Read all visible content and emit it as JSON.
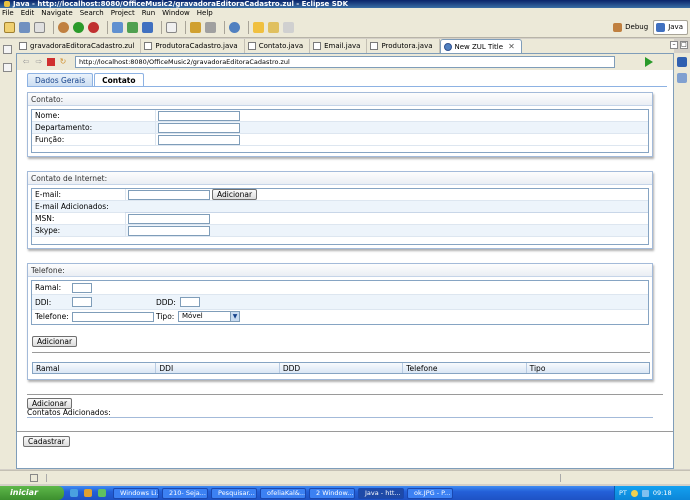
{
  "window": {
    "title": "Java - http://localhost:8080/OfficeMusic2/gravadoraEditoraCadastro.zul - Eclipse SDK"
  },
  "menu": [
    "File",
    "Edit",
    "Navigate",
    "Search",
    "Project",
    "Run",
    "Window",
    "Help"
  ],
  "perspectives": [
    {
      "label": "Debug",
      "active": false
    },
    {
      "label": "Java",
      "active": true
    }
  ],
  "editor_tabs": [
    {
      "label": "gravadoraEditoraCadastro.zul",
      "active": false
    },
    {
      "label": "ProdutoraCadastro.java",
      "active": false
    },
    {
      "label": "Contato.java",
      "active": false
    },
    {
      "label": "Email.java",
      "active": false
    },
    {
      "label": "Produtora.java",
      "active": false
    },
    {
      "label": "New ZUL Title",
      "active": true
    }
  ],
  "browser": {
    "url": "http://localhost:8080/OfficeMusic2/gravadoraEditoraCadastro.zul"
  },
  "page": {
    "tabs": [
      {
        "label": "Dados Gerais",
        "selected": false
      },
      {
        "label": "Contato",
        "selected": true
      }
    ],
    "contato": {
      "caption": "Contato:",
      "fields": [
        "Nome:",
        "Departamento:",
        "Função:"
      ]
    },
    "internet": {
      "caption": "Contato de Internet:",
      "email_label": "E-mail:",
      "add_label": "Adicionar",
      "added_label": "E-mail Adicionados:",
      "msn_label": "MSN:",
      "skype_label": "Skype:"
    },
    "telefone": {
      "caption": "Telefone:",
      "ramal_label": "Ramal:",
      "ddi_label": "DDI:",
      "ddd_label": "DDD:",
      "telefone_label": "Telefone:",
      "tipo_label": "Tipo:",
      "tipo_value": "Móvel",
      "add_label": "Adicionar",
      "columns": [
        "Ramal",
        "DDI",
        "DDD",
        "Telefone",
        "Tipo"
      ]
    },
    "contatos": {
      "add_label": "Adicionar",
      "added_label": "Contatos Adicionados:"
    },
    "submit_label": "Cadastrar"
  },
  "taskbar": {
    "start_label": "iniciar",
    "tasks": [
      "Windows Li...",
      "210- Seja...",
      "Pesquisar...",
      "ofeliaKal&...",
      "2 Window...",
      "Java - htt...",
      "ok.JPG - P..."
    ],
    "clock": "09:18",
    "lang": "PT"
  }
}
